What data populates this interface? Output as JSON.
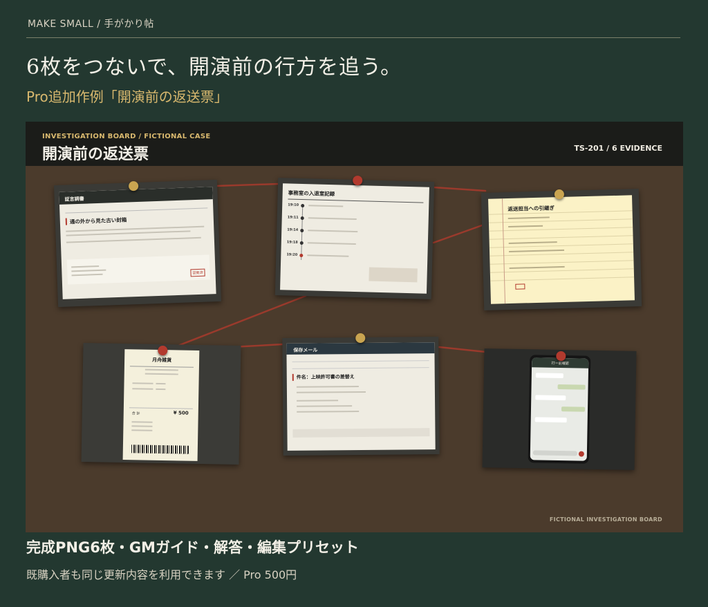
{
  "page": {
    "top_label": "MAKE SMALL / 手がかり帖",
    "headline": "6枚をつないで、開演前の行方を追う。",
    "subhead": "Pro追加作例「開演前の返送票」",
    "bottom_line1": "完成PNG6枚・GMガイド・解答・編集プリセット",
    "bottom_line2": "既購入者も同じ更新内容を利用できます ／ Pro 500円"
  },
  "board": {
    "kicker": "INVESTIGATION BOARD / FICTIONAL CASE",
    "title": "開演前の返送票",
    "code": "TS-201 / 6 EVIDENCE",
    "footer": "FICTIONAL INVESTIGATION BOARD",
    "colors": {
      "background": "#4b3b2c",
      "header": "#1b1c19",
      "string": "#9a3a2c"
    }
  },
  "cards": {
    "report": {
      "header_title": "証言調書",
      "heading": "通の外から見た古い封箱",
      "stamp": "証拠済"
    },
    "log": {
      "title": "事務室の入退室記録",
      "times": [
        "19:10",
        "19:11",
        "19:14",
        "19:18",
        "19:20"
      ]
    },
    "memo": {
      "title": "返送担当への引継ぎ"
    },
    "receipt": {
      "shop": "月舟雑貨",
      "total_label": "合 計",
      "total_value": "¥ 500"
    },
    "mail": {
      "header": "保存メール",
      "subject": "件名：上映許可書の差替え"
    },
    "phone": {
      "thread_title": "打ー前確認"
    }
  }
}
